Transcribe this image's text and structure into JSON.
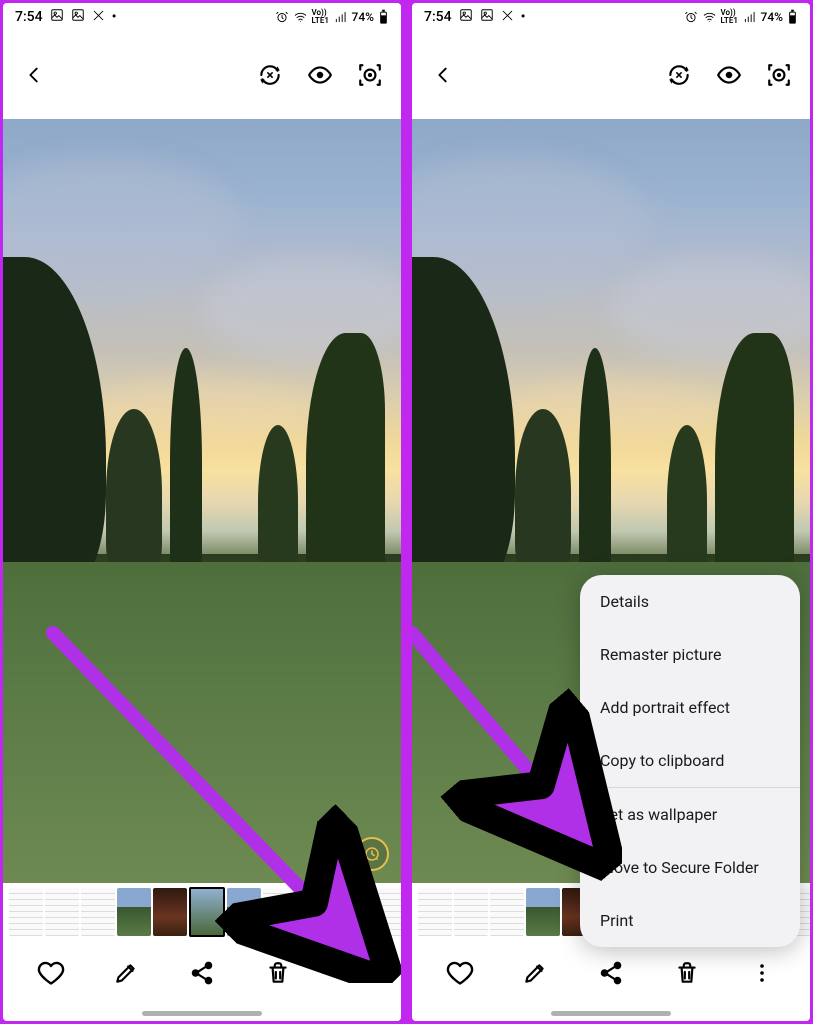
{
  "status": {
    "time": "7:54",
    "battery_pct": "74%",
    "net_label": "Vo)) LTE1",
    "notif_overflow": "•"
  },
  "top_nav": {
    "back": "Back",
    "remaster": "Remaster",
    "eye": "Preview",
    "bixby": "Bixby Vision"
  },
  "bottom": {
    "fav": "Favorite",
    "edit": "Edit",
    "share": "Share",
    "delete": "Delete",
    "more": "More options"
  },
  "menu": {
    "items": [
      "Details",
      "Remaster picture",
      "Add portrait effect",
      "Copy to clipboard",
      "Set as wallpaper",
      "Move to Secure Folder",
      "Print"
    ]
  },
  "annotation": {
    "arrow_color": "#b030e8"
  }
}
